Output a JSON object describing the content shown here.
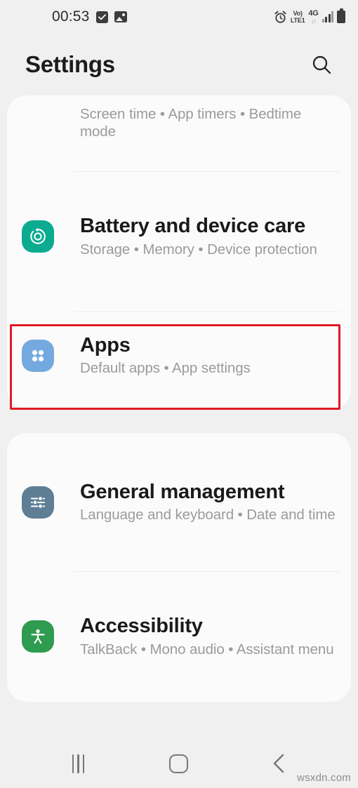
{
  "status_bar": {
    "clock": "00:53",
    "left_icons": [
      "checkbox-icon",
      "photo-icon"
    ],
    "right_icons": [
      "alarm-icon",
      "volte-icon",
      "4g-icon",
      "signal-icon",
      "battery-icon"
    ],
    "volte_line1": "Vo)",
    "volte_line2": "LTE1",
    "network": "4G",
    "data_arrows": "↓↑"
  },
  "header": {
    "title": "Settings",
    "search_icon": "search-icon"
  },
  "cards": [
    {
      "id": "card-one",
      "items": [
        {
          "name": "digital-wellbeing",
          "title": "",
          "icon": "none",
          "icon_color": "",
          "subtitle_parts": [
            "Screen time",
            "App timers",
            "Bedtime mode"
          ],
          "subtitle": "Screen time  •  App timers  •  Bedtime mode",
          "partial": true
        },
        {
          "name": "battery-and-device-care",
          "title": "Battery and device care",
          "icon": "battery-care-icon",
          "icon_color": "#0aab90",
          "subtitle_parts": [
            "Storage",
            "Memory",
            "Device protection"
          ],
          "subtitle": "Storage  •  Memory  •  Device protection"
        },
        {
          "name": "apps",
          "title": "Apps",
          "icon": "apps-grid-icon",
          "icon_color": "#74a9e0",
          "subtitle_parts": [
            "Default apps",
            "App settings"
          ],
          "subtitle": "Default apps  •  App settings",
          "highlighted": true
        }
      ]
    },
    {
      "id": "card-two",
      "items": [
        {
          "name": "general-management",
          "title": "General management",
          "icon": "sliders-icon",
          "icon_color": "#5e7e95",
          "subtitle_parts": [
            "Language and keyboard",
            "Date and time"
          ],
          "subtitle": "Language and keyboard  •  Date and time"
        },
        {
          "name": "accessibility",
          "title": "Accessibility",
          "icon": "accessibility-person-icon",
          "icon_color": "#2e9b50",
          "subtitle_parts": [
            "TalkBack",
            "Mono audio",
            "Assistant menu"
          ],
          "subtitle": "TalkBack  •  Mono audio  •  Assistant menu"
        }
      ]
    }
  ],
  "highlight": {
    "target": "apps",
    "color": "#e01b24"
  },
  "nav_bar": {
    "recents_label": "recents-icon",
    "home_label": "home-icon",
    "back_label": "back-icon"
  },
  "watermark": "wsxdn.com",
  "colors": {
    "page_background": "#f0f0f0",
    "card_background": "#fbfbfb",
    "title_text": "#1a1a1a",
    "subtitle_text": "#9b9b9b",
    "divider": "#ececed",
    "highlight_red": "#e01b24"
  }
}
